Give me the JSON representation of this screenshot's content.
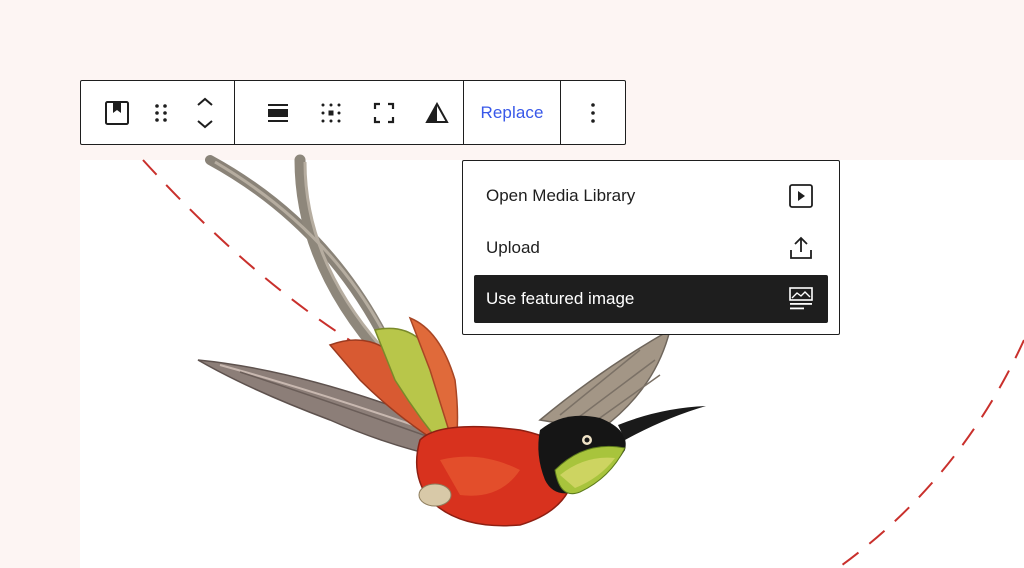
{
  "toolbar": {
    "replace_label": "Replace",
    "icons": [
      "featured-image-icon",
      "drag-handle-icon",
      "move-up-down-icon",
      "align-icon",
      "focal-point-icon",
      "fullscreen-icon",
      "duotone-icon",
      "more-options-icon"
    ]
  },
  "dropdown": {
    "items": [
      {
        "label": "Open Media Library",
        "icon": "media-library-icon",
        "active": false
      },
      {
        "label": "Upload",
        "icon": "upload-icon",
        "active": false
      },
      {
        "label": "Use featured image",
        "icon": "featured-image-icon",
        "active": true
      }
    ]
  },
  "colors": {
    "accent": "#3858e9",
    "page_background": "#fdf5f3",
    "dark": "#1e1e1e",
    "dash_circle": "#c9302c"
  }
}
